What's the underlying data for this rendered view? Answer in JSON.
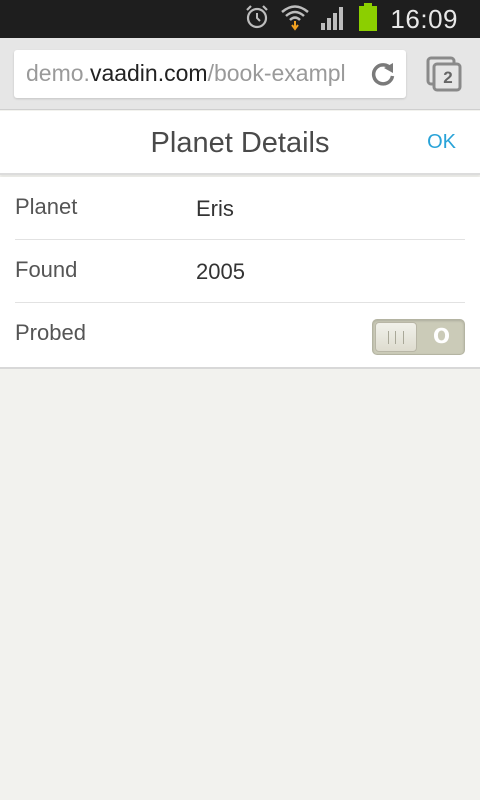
{
  "status_bar": {
    "time": "16:09",
    "icons": [
      "alarm-icon",
      "wifi-icon",
      "signal-icon",
      "battery-icon"
    ],
    "battery_color": "#8ccf00"
  },
  "browser": {
    "url_prefix": "demo.",
    "url_host": "vaadin.com",
    "url_path": "/book-exampl",
    "tab_count": "2"
  },
  "nav": {
    "title": "Planet Details",
    "ok_label": "OK",
    "ok_color": "#29a3d8"
  },
  "form": {
    "rows": [
      {
        "label": "Planet",
        "value": "Eris"
      },
      {
        "label": "Found",
        "value": "2005"
      },
      {
        "label": "Probed",
        "switch_state": "O",
        "checked": false
      }
    ]
  }
}
